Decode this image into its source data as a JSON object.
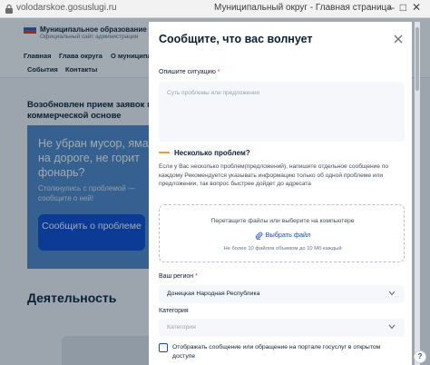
{
  "browser": {
    "url": "volodarskoe.gosuslugi.ru",
    "window_title": "Муниципальный округ - Главная страница"
  },
  "site": {
    "org_name": "Муниципальное образование В",
    "org_subtitle": "Официальный сайт администрации",
    "nav": [
      "Главная",
      "Глава округа",
      "О муниципа",
      "События",
      "Контакты"
    ],
    "news": "Возобновлен прием заявок на коммерческой основе",
    "promo": {
      "title": "Не убран мусор, яма на дороге, не горит фонарь?",
      "text": "Столкнулись с проблемой — сообщите о ней!",
      "button": "Сообщить о проблеме"
    },
    "activity_title": "Деятельность"
  },
  "modal": {
    "title": "Сообщите, что вас волнует",
    "situation_label": "Опишите ситуацию",
    "required_mark": "*",
    "situation_placeholder": "Суть проблемы или предложения",
    "multi_title": "Несколько проблем?",
    "multi_text": "Если у Вас несколько проблем(предложений), напишите отдельное сообщение по каждому Рекомендуется указывать информацию только об одной проблеме или предложении, так вопрос быстрее дойдет до адресата",
    "dropzone_text": "Перетащите файлы или выберите на компьютере",
    "dropzone_link": "Выбрать файл",
    "dropzone_note": "Не более 10 файлов объемом до 10 Мб каждый",
    "region_label": "Ваш регион",
    "region_value": "Донецкая Народная Республика",
    "category_label": "Категория",
    "category_placeholder": "Категория",
    "publish_label": "Отображать сообщение или обращение на портале госуслуг в открытом доступе"
  },
  "colors": {
    "accent": "#0d4cd3",
    "warning": "#e7a42d",
    "promo_bg": "#4f88c8"
  },
  "icons": [
    "lock-icon",
    "emblem-icon",
    "close-icon",
    "paperclip-icon",
    "chevron-down-icon",
    "help-icon"
  ]
}
